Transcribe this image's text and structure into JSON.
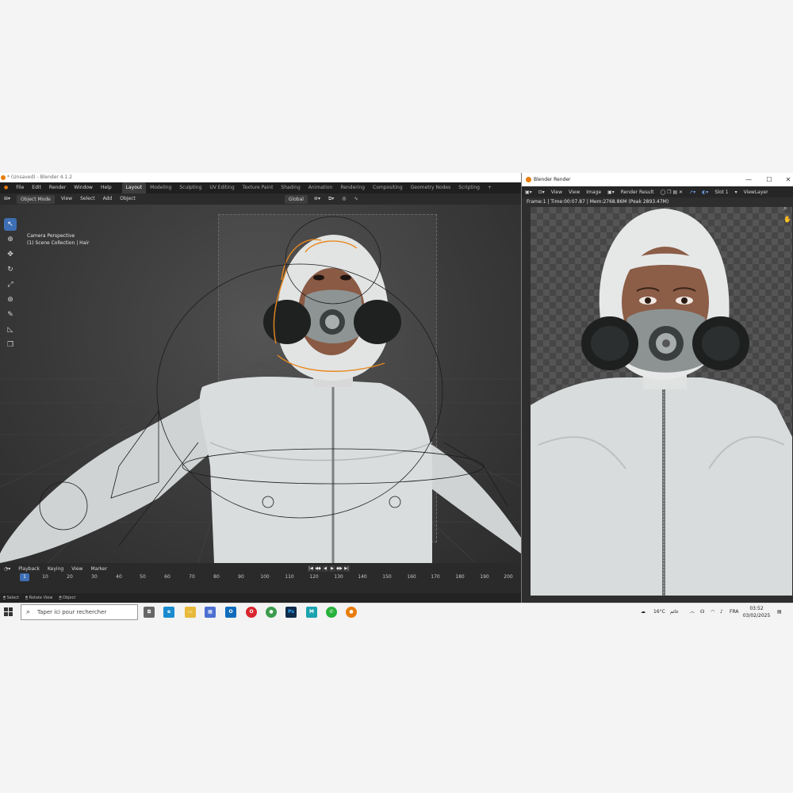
{
  "blender": {
    "title": "* (Unsaved) - Blender 4.1.2",
    "menu": [
      "File",
      "Edit",
      "Render",
      "Window",
      "Help"
    ],
    "workspaces": [
      {
        "label": "Layout",
        "active": true
      },
      {
        "label": "Modeling",
        "active": false
      },
      {
        "label": "Sculpting",
        "active": false
      },
      {
        "label": "UV Editing",
        "active": false
      },
      {
        "label": "Texture Paint",
        "active": false
      },
      {
        "label": "Shading",
        "active": false
      },
      {
        "label": "Animation",
        "active": false
      },
      {
        "label": "Rendering",
        "active": false
      },
      {
        "label": "Compositing",
        "active": false
      },
      {
        "label": "Geometry Nodes",
        "active": false
      },
      {
        "label": "Scripting",
        "active": false
      }
    ],
    "add_workspace": "+",
    "header": {
      "mode": "Object Mode",
      "items": [
        "View",
        "Select",
        "Add",
        "Object"
      ],
      "transform_orientation": "Global"
    },
    "viewport": {
      "camera_label": "Camera Perspective",
      "collection_label": "(1) Scene Collection | Hair"
    },
    "toolbar_icons": [
      "select-cursor-icon",
      "cursor-icon",
      "move-icon",
      "rotate-icon",
      "scale-icon",
      "transform-icon",
      "annotate-icon",
      "measure-icon",
      "add-cube-icon"
    ],
    "timeline": {
      "menu": [
        "Playback",
        "Keying",
        "View",
        "Marker"
      ],
      "current_frame": "1",
      "ticks": [
        "10",
        "20",
        "30",
        "40",
        "50",
        "60",
        "70",
        "80",
        "90",
        "100",
        "110",
        "120",
        "130",
        "140",
        "150",
        "160",
        "170",
        "180",
        "190",
        "200"
      ]
    },
    "status": [
      "Select",
      "Rotate View",
      "Object"
    ]
  },
  "render_window": {
    "title": "Blender Render",
    "header": {
      "items": [
        "View",
        "View",
        "Image"
      ],
      "image_name": "Render Result",
      "slot": "Slot 1",
      "view_layer": "ViewLayer"
    },
    "info": "Frame:1 | Time:00:07.87 | Mem:2768.86M (Peak 2893.47M)"
  },
  "taskbar": {
    "search_placeholder": "Taper ici pour rechercher",
    "weather": "16°C",
    "weather_text": "غائم",
    "language": "FRA",
    "time": "03:52",
    "date": "03/02/2025",
    "apps": [
      "Task View",
      "Edge",
      "File Explorer",
      "Store",
      "Outlook",
      "Opera",
      "Chrome",
      "Photoshop",
      "Maya",
      "WhatsApp",
      "Blender"
    ]
  },
  "colors": {
    "accent_blue": "#3e6fb5",
    "selection_orange": "#e8891f",
    "blender_orange": "#e87d0d"
  }
}
